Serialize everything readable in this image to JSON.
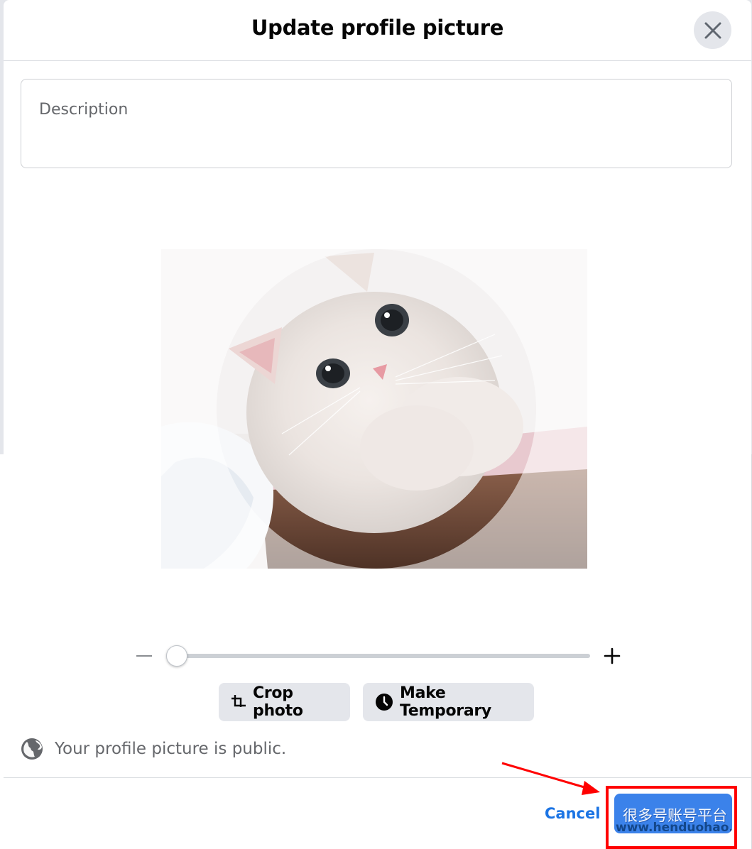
{
  "dialog": {
    "title": "Update profile picture",
    "close_icon": "close-icon"
  },
  "description": {
    "placeholder": "Description",
    "value": ""
  },
  "photo": {
    "subject": "white kitten photo with circular crop overlay"
  },
  "zoom": {
    "level": 0,
    "minus_icon": "minus-icon",
    "plus_icon": "plus-icon"
  },
  "actions": {
    "crop_label": "Crop photo",
    "crop_icon": "crop-icon",
    "temporary_label": "Make Temporary",
    "temporary_icon": "clock-icon"
  },
  "privacy": {
    "icon": "globe-icon",
    "text": "Your profile picture is public."
  },
  "footer": {
    "cancel_label": "Cancel",
    "save_label": "很多号账号平台",
    "watermark_url": "www.henduohao.com"
  },
  "annotation": {
    "highlight_color": "#ff0000",
    "arrow_color": "#ff0000"
  },
  "colors": {
    "primary_blue": "#1b74e4",
    "button_blue": "#3b82ea",
    "secondary_bg": "#e4e6eb",
    "secondary_text": "#65676b"
  }
}
